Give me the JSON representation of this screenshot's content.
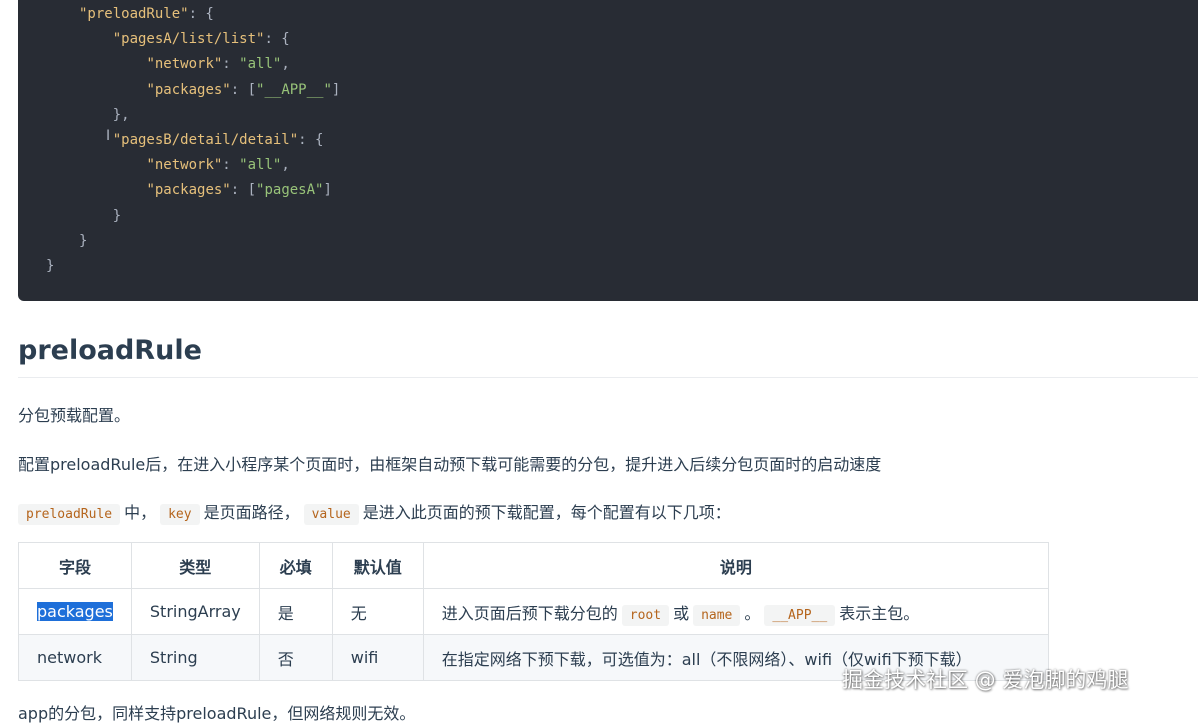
{
  "code": {
    "lines": [
      [
        [
          "k",
          "\"preloadRule\""
        ],
        [
          "p",
          ": {"
        ]
      ],
      [
        [
          "p",
          "    "
        ],
        [
          "k",
          "\"pagesA/list/list\""
        ],
        [
          "p",
          ": {"
        ]
      ],
      [
        [
          "p",
          "        "
        ],
        [
          "k",
          "\"network\""
        ],
        [
          "p",
          ": "
        ],
        [
          "s",
          "\"all\""
        ],
        [
          "p",
          ","
        ]
      ],
      [
        [
          "p",
          "        "
        ],
        [
          "k",
          "\"packages\""
        ],
        [
          "p",
          ": ["
        ],
        [
          "s",
          "\"__APP__\""
        ],
        [
          "p",
          "]"
        ]
      ],
      [
        [
          "p",
          "    },"
        ]
      ],
      [
        [
          "p",
          "    "
        ],
        [
          "k",
          "\"pagesB/detail/detail\""
        ],
        [
          "p",
          ": {"
        ]
      ],
      [
        [
          "p",
          "        "
        ],
        [
          "k",
          "\"network\""
        ],
        [
          "p",
          ": "
        ],
        [
          "s",
          "\"all\""
        ],
        [
          "p",
          ","
        ]
      ],
      [
        [
          "p",
          "        "
        ],
        [
          "k",
          "\"packages\""
        ],
        [
          "p",
          ": ["
        ],
        [
          "s",
          "\"pagesA\""
        ],
        [
          "p",
          "]"
        ]
      ],
      [
        [
          "p",
          "    }"
        ]
      ],
      [
        [
          "p",
          "}"
        ]
      ]
    ],
    "last_line": "}"
  },
  "section": {
    "title": "preloadRule",
    "intro": "分包预载配置。",
    "desc": "配置preloadRule后，在进入小程序某个页面时，由框架自动预下载可能需要的分包，提升进入后续分包页面时的启动速度",
    "keys_line": {
      "code1": "preloadRule",
      "t1": "中，",
      "code2": "key",
      "t2": "是页面路径，",
      "code3": "value",
      "t3": "是进入此页面的预下载配置，每个配置有以下几项："
    }
  },
  "table": {
    "headers": [
      "字段",
      "类型",
      "必填",
      "默认值",
      "说明"
    ],
    "row1": {
      "field": "packages",
      "type": "StringArray",
      "required": "是",
      "default": "无",
      "desc_a": "进入页面后预下载分包的",
      "code_a": "root",
      "desc_b": "或",
      "code_b": "name",
      "desc_c": "。",
      "code_c": "__APP__",
      "desc_d": "表示主包。"
    },
    "row2": {
      "field": "network",
      "type": "String",
      "required": "否",
      "default": "wifi",
      "desc": "在指定网络下预下载，可选值为：all（不限网络）、wifi（仅wifi下预下载）"
    }
  },
  "cut_text": "app的分包，同样支持preloadRule，但网络规则无效。",
  "watermark": "掘金技术社区 @ 爱泡脚的鸡腿"
}
